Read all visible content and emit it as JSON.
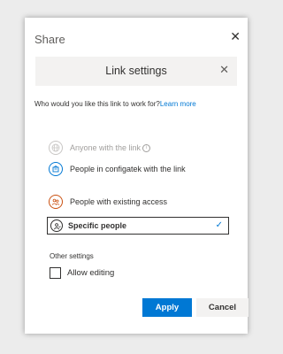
{
  "dialog": {
    "title": "Share",
    "close_icon": "close-icon"
  },
  "link_settings": {
    "title": "Link settings",
    "close_icon": "close-icon",
    "question": "Who would you like this link to work for?",
    "learn_more": "Learn more",
    "options": [
      {
        "label": "Anyone with the link",
        "icon": "globe-icon",
        "state": "disabled",
        "has_info": true
      },
      {
        "label": "People in configatek with the link",
        "icon": "building-icon",
        "state": "enabled"
      },
      {
        "label": "People with existing access",
        "icon": "people-icon",
        "state": "enabled"
      },
      {
        "label": "Specific people",
        "icon": "person-icon",
        "state": "selected"
      }
    ],
    "info_glyph": "i",
    "check_glyph": "✓"
  },
  "other_settings": {
    "heading": "Other settings",
    "allow_editing_label": "Allow editing",
    "allow_editing_checked": false
  },
  "buttons": {
    "apply": "Apply",
    "cancel": "Cancel"
  },
  "colors": {
    "accent": "#0078d4",
    "existing_access": "#ca5010",
    "disabled": "#a19f9d"
  }
}
